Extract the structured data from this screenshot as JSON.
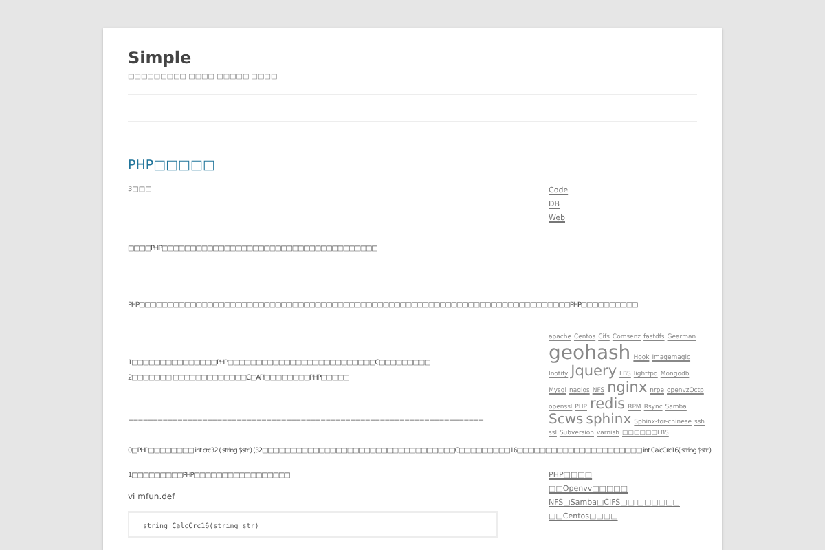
{
  "site": {
    "title": "Simple",
    "tagline": "□□□□□□□□□ □□□□ □□□□□ □□□□"
  },
  "post": {
    "title": "PHP□□□□□",
    "meta": "3□□□",
    "blocks": [
      {
        "kind": "p",
        "text": "□□□□PHP□□□□□□□□□□□□□□□□□□□□□□□□□□□□□□□□□□□□□□"
      },
      {
        "kind": "p",
        "text": "PHP□□□□□□□□□□□□□□□□□□□□□□□□□□□□□□□□□□□□□□□□□□□□□□□□□□□□□□□□□□□□□□□□□□□□□□□□□□□□PHP□□□□□□□□□□"
      },
      {
        "kind": "lines",
        "lines": [
          "1□□□□□□□□□□□□□□□PHP□□□□□□□□□□□□□□□□□□□□□□□□□□C□□□□□□□□□",
          "2□□□□□□□ □□□□□□□□□□□□□C□API□□□□□□□□PHP□□□□□"
        ]
      },
      {
        "kind": "p",
        "text": "========================================================================"
      },
      {
        "kind": "p",
        "text": "0□PHP□□□□□□□□ int crc32 ( string $str ) (32□□□□□□□□□□□□□□□□□□□□□□□□□□□□□□□□□□C□□□□□□□□□16□□□□□□□□□□□□□□□□□□□□□□ int CalcCrc16( string $str )"
      },
      {
        "kind": "p",
        "text": "1□□□□□□□□□PHP□□□□□□□□□□□□□□□□□"
      },
      {
        "kind": "p",
        "text": "vi mfun.def"
      },
      {
        "kind": "code",
        "text": "string CalcCrc16(string str)"
      }
    ]
  },
  "sidebar": {
    "categories": [
      "Code",
      "DB",
      "Web"
    ],
    "tags": [
      {
        "text": "apache",
        "kind": "small"
      },
      {
        "text": "Centos",
        "kind": "small"
      },
      {
        "text": "Cifs",
        "kind": "small"
      },
      {
        "text": "Comsenz",
        "kind": "small"
      },
      {
        "text": "fastdfs",
        "kind": "small"
      },
      {
        "text": "Gearman",
        "kind": "small"
      },
      {
        "text": "geohash",
        "kind": "huge"
      },
      {
        "text": "Hook",
        "kind": "small"
      },
      {
        "text": "Imagemagic",
        "kind": "small"
      },
      {
        "text": "Inotify",
        "kind": "small"
      },
      {
        "text": "Jquery",
        "kind": "large"
      },
      {
        "text": "LBS",
        "kind": "small"
      },
      {
        "text": "lighttpd",
        "kind": "small"
      },
      {
        "text": "Mongodb",
        "kind": "small"
      },
      {
        "text": "Mysql",
        "kind": "small"
      },
      {
        "text": "nagios",
        "kind": "small"
      },
      {
        "text": "NFS",
        "kind": "small"
      },
      {
        "text": "nginx",
        "kind": "large"
      },
      {
        "text": "nrpe",
        "kind": "small"
      },
      {
        "text": "openvzOctp",
        "kind": "small"
      },
      {
        "text": "openssl",
        "kind": "small"
      },
      {
        "text": "PHP",
        "kind": "small"
      },
      {
        "text": "redis",
        "kind": "large"
      },
      {
        "text": "RPM",
        "kind": "small"
      },
      {
        "text": "Rsync",
        "kind": "small"
      },
      {
        "text": "Samba",
        "kind": "small"
      },
      {
        "text": "Scws",
        "kind": "medium"
      },
      {
        "text": "sphinx",
        "kind": "medium"
      },
      {
        "text": "Sphinx-for-chinese",
        "kind": "small"
      },
      {
        "text": "ssh",
        "kind": "small"
      },
      {
        "text": "ssl",
        "kind": "small"
      },
      {
        "text": "Subversion",
        "kind": "small"
      },
      {
        "text": "varnish",
        "kind": "small"
      },
      {
        "text": "□□□□□□LBS",
        "kind": "small"
      }
    ],
    "recent": [
      "PHP□□□□",
      "□□Openvv□□□□□",
      "NFS□Samba□CIFS□□ □□□□□□",
      "□□Centos□□□□"
    ]
  }
}
